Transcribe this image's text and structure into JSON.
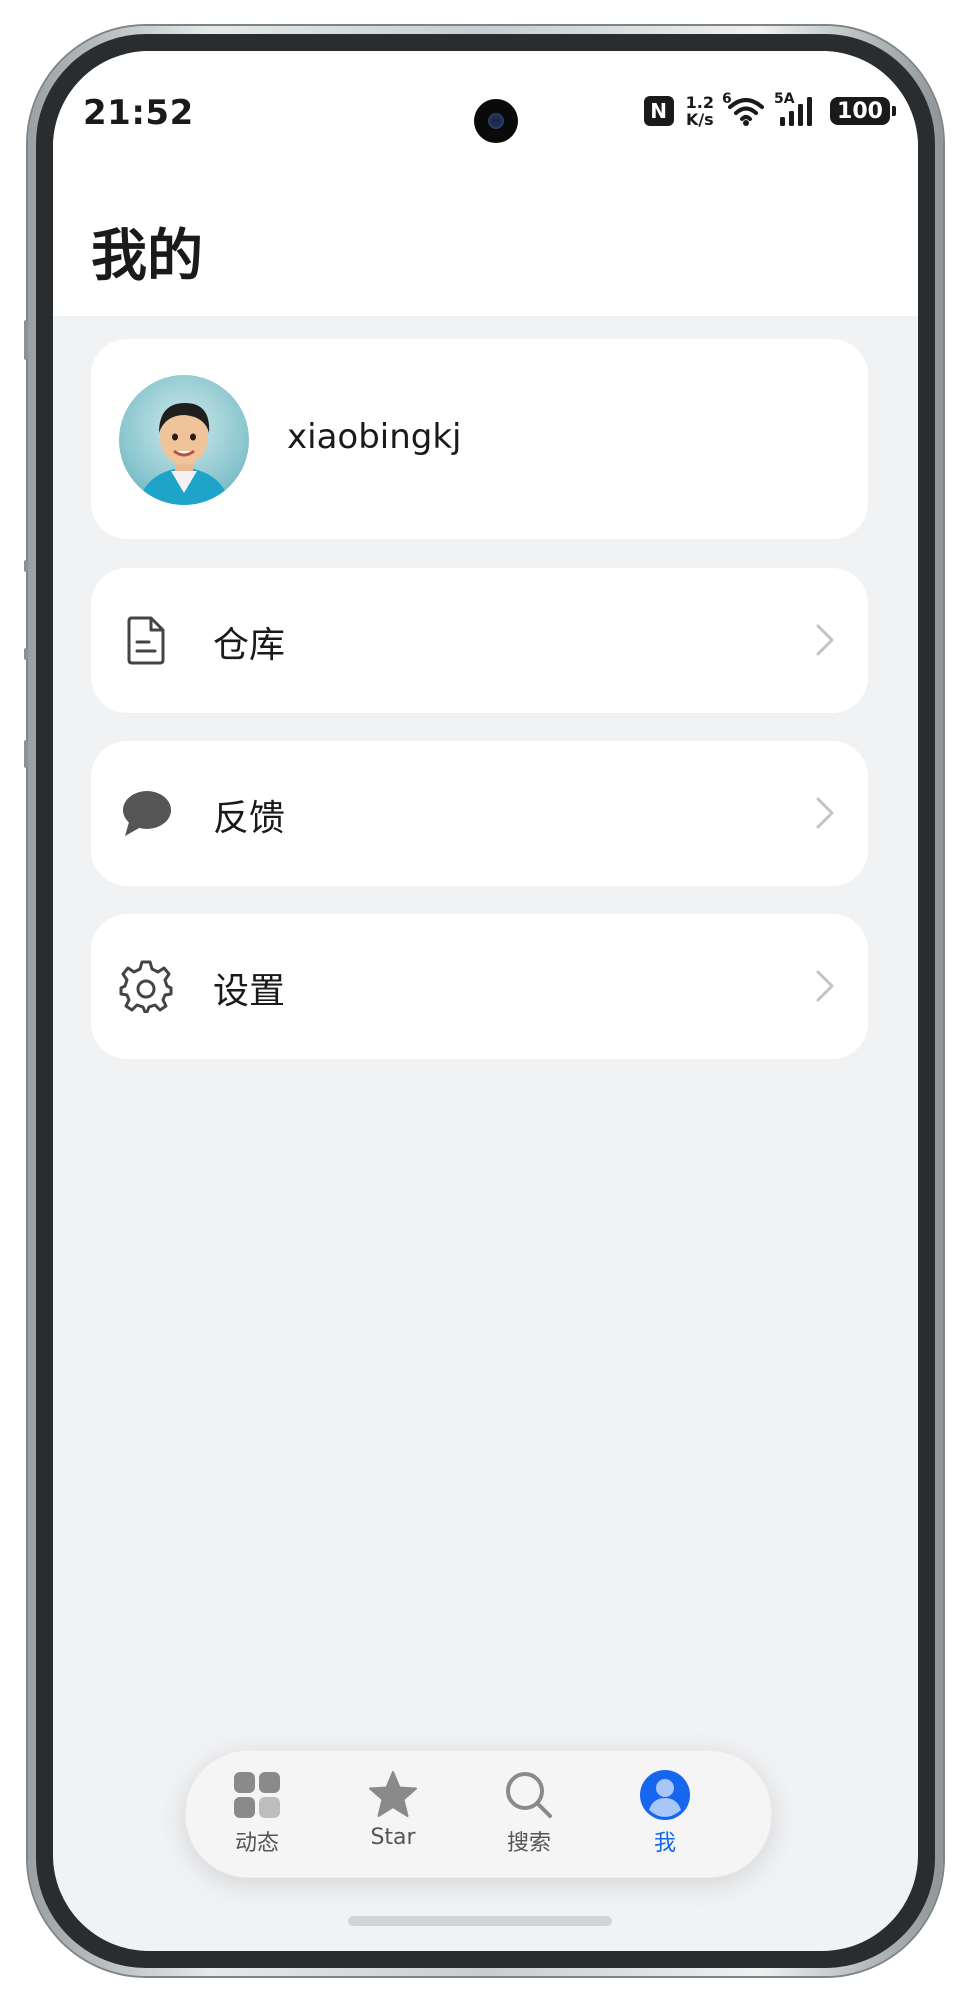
{
  "status_bar": {
    "time": "21:52",
    "nfc": "N",
    "net_speed_value": "1.2",
    "net_speed_unit": "K/s",
    "wifi_tag": "6",
    "signal_tag": "5A",
    "battery": "100",
    "icons": [
      "nfc-icon",
      "wifi-icon",
      "signal-icon",
      "battery-icon"
    ]
  },
  "header": {
    "title": "我的"
  },
  "profile": {
    "username": "xiaobingkj"
  },
  "menu": [
    {
      "label": "仓库",
      "icon": "document-icon"
    },
    {
      "label": "反馈",
      "icon": "chat-bubble-icon"
    },
    {
      "label": "设置",
      "icon": "gear-icon"
    }
  ],
  "bottom_nav": {
    "active_color": "#1766f0",
    "inactive_color": "#8a8a8a",
    "items": [
      {
        "label": "动态",
        "icon": "grid-icon",
        "active": false
      },
      {
        "label": "Star",
        "icon": "star-icon",
        "active": false
      },
      {
        "label": "搜索",
        "icon": "search-icon",
        "active": false
      },
      {
        "label": "我",
        "icon": "person-icon",
        "active": true
      }
    ]
  }
}
